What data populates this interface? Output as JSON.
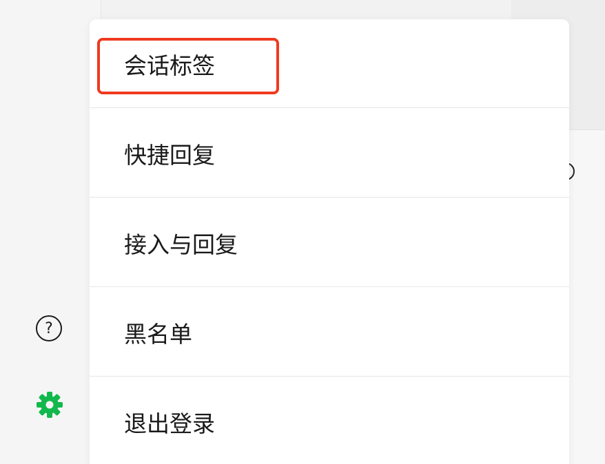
{
  "sidebar": {
    "help_icon_glyph": "?",
    "settings_icon_color": "#12b84c"
  },
  "menu": {
    "items": [
      {
        "label": "会话标签",
        "highlighted": true
      },
      {
        "label": "快捷回复",
        "highlighted": false
      },
      {
        "label": "接入与回复",
        "highlighted": false
      },
      {
        "label": "黑名单",
        "highlighted": false
      },
      {
        "label": "退出登录",
        "highlighted": false
      }
    ],
    "highlight_color": "#ef3a1f"
  }
}
